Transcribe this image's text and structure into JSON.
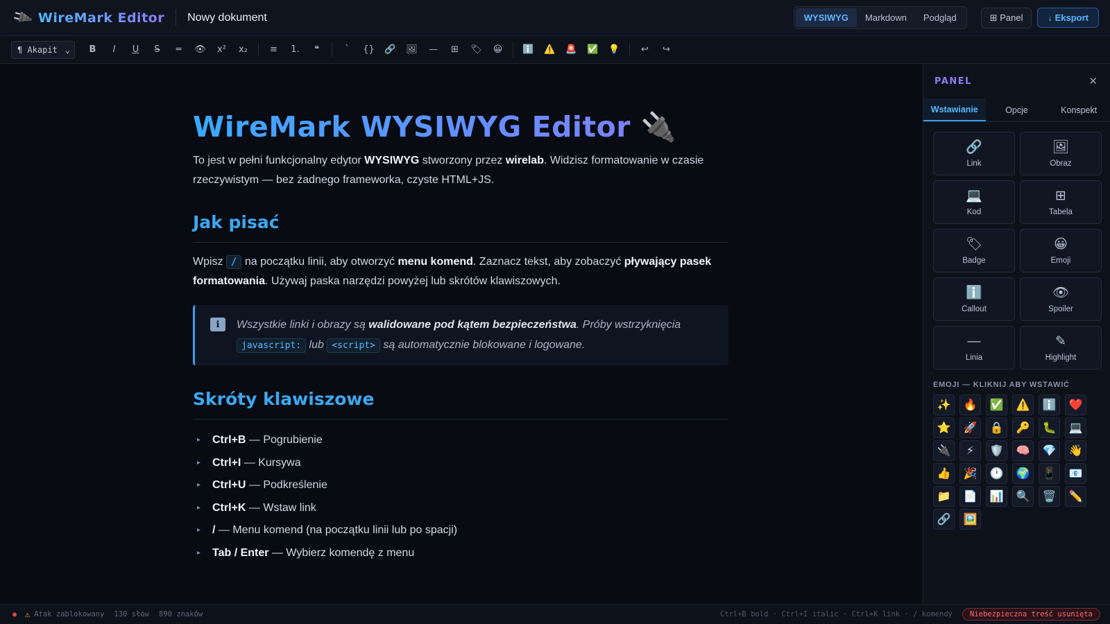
{
  "app": {
    "logo_icon": "plug-icon",
    "logo_glyph": "🔌",
    "name": "WireMark Editor",
    "doc_title": "Nowy dokument"
  },
  "header": {
    "modes": [
      "WYSIWYG",
      "Markdown",
      "Podgląd"
    ],
    "active_mode": "WYSIWYG",
    "panel_label": "⊞ Panel",
    "export_label": "↓ Eksport"
  },
  "toolbar": {
    "block_type": "¶ Akapit",
    "groups": [
      [
        {
          "name": "bold",
          "glyph": "B"
        },
        {
          "name": "italic",
          "glyph": "I"
        },
        {
          "name": "underline",
          "glyph": "U"
        },
        {
          "name": "strikethrough",
          "glyph": "S"
        },
        {
          "name": "highlight",
          "glyph": "═"
        },
        {
          "name": "spoiler",
          "glyph": "👁"
        },
        {
          "name": "superscript",
          "glyph": "x²"
        },
        {
          "name": "subscript",
          "glyph": "x₂"
        }
      ],
      [
        {
          "name": "bullet-list",
          "glyph": "≡"
        },
        {
          "name": "ordered-list",
          "glyph": "1."
        },
        {
          "name": "quote",
          "glyph": "❝"
        }
      ],
      [
        {
          "name": "inline-code",
          "glyph": "`"
        },
        {
          "name": "code-block",
          "glyph": "{}"
        },
        {
          "name": "link",
          "glyph": "🔗"
        },
        {
          "name": "image",
          "glyph": "🖼"
        },
        {
          "name": "horizontal-rule",
          "glyph": "—"
        },
        {
          "name": "table",
          "glyph": "⊞"
        },
        {
          "name": "badge",
          "glyph": "🏷"
        },
        {
          "name": "emoji",
          "glyph": "😀"
        }
      ],
      [
        {
          "name": "callout-info",
          "glyph": "ℹ️"
        },
        {
          "name": "callout-warning",
          "glyph": "⚠️"
        },
        {
          "name": "callout-danger",
          "glyph": "🚨"
        },
        {
          "name": "callout-success",
          "glyph": "✅"
        },
        {
          "name": "callout-tip",
          "glyph": "💡"
        }
      ],
      [
        {
          "name": "undo",
          "glyph": "↩"
        },
        {
          "name": "redo",
          "glyph": "↪"
        }
      ]
    ]
  },
  "doc": {
    "h1_text": "WireMark WYSIWYG Editor",
    "h1_emoji": "🔌",
    "intro": [
      "To jest w pełni funkcjonalny edytor ",
      "WYSIWYG",
      " stworzony przez ",
      "wirelab",
      ". Widzisz formatowanie w czasie rzeczywistym — bez żadnego frameworka, czyste HTML+JS."
    ],
    "h2_howto": "Jak pisać",
    "howto": [
      "Wpisz ",
      "/",
      " na początku linii, aby otworzyć ",
      "menu komend",
      ". Zaznacz tekst, aby zobaczyć ",
      "pływający pasek formatowania",
      ". Używaj paska narzędzi powyżej lub skrótów klawiszowych."
    ],
    "callout_icon": "ℹ",
    "callout": [
      "Wszystkie linki i obrazy są ",
      "walidowane pod kątem bezpieczeństwa",
      ". Próby wstrzyknięcia ",
      "javascript:",
      " lub ",
      "<script>",
      " są automatycznie blokowane i logowane."
    ],
    "h2_shortcuts": "Skróty klawiszowe",
    "shortcuts": [
      {
        "key": "Ctrl+B",
        "desc": " — Pogrubienie"
      },
      {
        "key": "Ctrl+I",
        "desc": " — Kursywa"
      },
      {
        "key": "Ctrl+U",
        "desc": " — Podkreślenie"
      },
      {
        "key": "Ctrl+K",
        "desc": " — Wstaw link"
      },
      {
        "key": "/",
        "desc": " — Menu komend (na początku linii lub po spacji)"
      },
      {
        "key": "Tab / Enter",
        "desc": " — Wybierz komendę z menu"
      }
    ]
  },
  "panel": {
    "title": "PANEL",
    "close": "✕",
    "tabs": [
      "Wstawianie",
      "Opcje",
      "Konspekt"
    ],
    "active_tab": "Wstawianie",
    "insert_items": [
      {
        "label": "Link",
        "glyph": "🔗",
        "icon": "link-icon"
      },
      {
        "label": "Obraz",
        "glyph": "🖼",
        "icon": "image-icon"
      },
      {
        "label": "Kod",
        "glyph": "💻",
        "icon": "laptop-icon"
      },
      {
        "label": "Tabela",
        "glyph": "⊞",
        "icon": "table-icon"
      },
      {
        "label": "Badge",
        "glyph": "🏷",
        "icon": "tag-icon"
      },
      {
        "label": "Emoji",
        "glyph": "😀",
        "icon": "smiley-icon"
      },
      {
        "label": "Callout",
        "glyph": "ℹ️",
        "icon": "info-icon"
      },
      {
        "label": "Spoiler",
        "glyph": "👁",
        "icon": "eye-icon"
      },
      {
        "label": "Linia",
        "glyph": "—",
        "icon": "line-icon"
      },
      {
        "label": "Highlight",
        "glyph": "✎",
        "icon": "pencil-icon"
      }
    ],
    "emoji_heading": "EMOJI — KLIKNIJ ABY WSTAWIĆ",
    "emojis": [
      "✨",
      "🔥",
      "✅",
      "⚠️",
      "ℹ️",
      "❤️",
      "⭐",
      "🚀",
      "🔒",
      "🔑",
      "🐛",
      "💻",
      "🔌",
      "⚡",
      "🛡️",
      "🧠",
      "💎",
      "👋",
      "👍",
      "🎉",
      "🕐",
      "🌍",
      "📱",
      "📧",
      "📁",
      "📄",
      "📊",
      "🔍",
      "🗑️",
      "✏️",
      "🔗",
      "🖼️"
    ]
  },
  "status": {
    "dot": "●",
    "warning": "⚠",
    "attack_text": "Atak zablokowany",
    "words": "130 słów",
    "chars": "890 znaków",
    "shortcuts_hint": "Ctrl+B bold · Ctrl+I italic · Ctrl+K link · / komendy",
    "alert_badge": "Niebezpieczna treść usunięta"
  },
  "colors": {
    "accent": "#3aa0ea",
    "brand_gradient_start": "#4fb8ff",
    "brand_gradient_end": "#8b7cf6",
    "danger": "#ff6b73",
    "warning": "#e6b32c"
  }
}
